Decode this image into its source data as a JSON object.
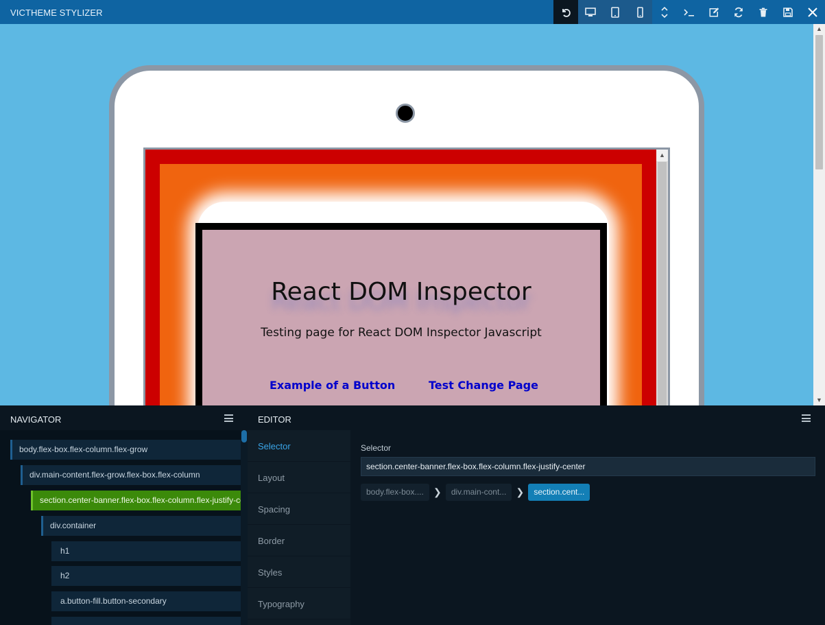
{
  "app": {
    "title": "VICTHEME STYLIZER"
  },
  "toolbar": {
    "buttons": [
      {
        "icon": "undo-icon",
        "state": "active"
      },
      {
        "icon": "desktop-icon"
      },
      {
        "icon": "tablet-icon"
      },
      {
        "icon": "mobile-icon"
      },
      {
        "icon": "vertical-resize-icon"
      },
      {
        "icon": "terminal-icon"
      },
      {
        "icon": "edit-icon"
      },
      {
        "icon": "refresh-icon"
      },
      {
        "icon": "trash-icon"
      },
      {
        "icon": "save-icon"
      },
      {
        "icon": "close-icon"
      }
    ]
  },
  "preview": {
    "title": "React DOM Inspector",
    "subtitle": "Testing page for React DOM Inspector Javascript",
    "links": [
      "Example of a Button",
      "Test Change Page"
    ]
  },
  "navigator": {
    "title": "NAVIGATOR",
    "items": [
      {
        "label": "body.flex-box.flex-column.flex-grow"
      },
      {
        "label": "div.main-content.flex-grow.flex-box.flex-column"
      },
      {
        "label": "section.center-banner.flex-box.flex-column.flex-justify-center",
        "selected": true
      },
      {
        "label": "div.container"
      },
      {
        "label": "h1"
      },
      {
        "label": "h2"
      },
      {
        "label": "a.button-fill.button-secondary"
      },
      {
        "label": ""
      }
    ]
  },
  "editor": {
    "title": "EDITOR",
    "tabs": [
      "Selector",
      "Layout",
      "Spacing",
      "Border",
      "Styles",
      "Typography"
    ],
    "active_tab": "Selector",
    "selector_label": "Selector",
    "selector_value": "section.center-banner.flex-box.flex-column.flex-justify-center",
    "breadcrumbs": [
      "body.flex-box....",
      "div.main-cont...",
      "section.cent..."
    ]
  },
  "colors": {
    "topbar": "#0f64a2",
    "canvas": "#5db8e3",
    "accent": "#3aa5e8",
    "selected": "#3b8a0a"
  }
}
